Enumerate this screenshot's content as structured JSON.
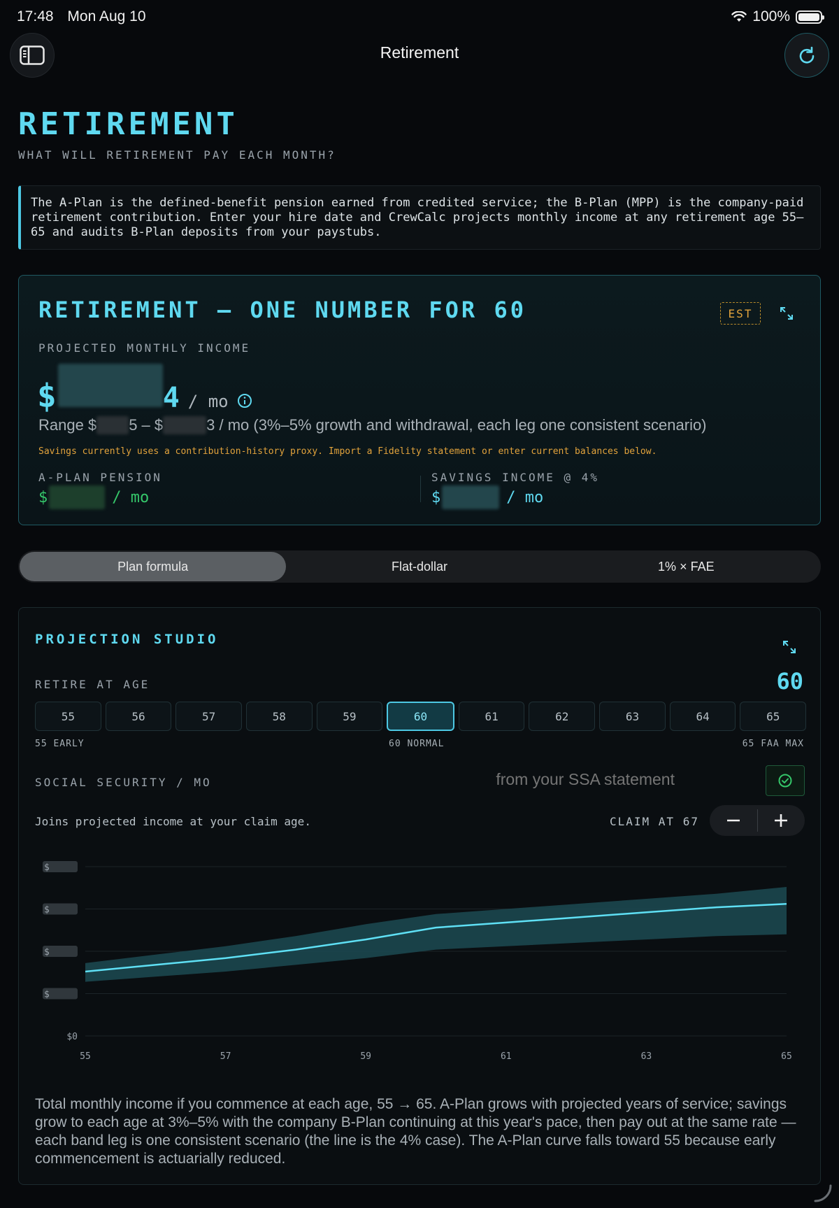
{
  "status_bar": {
    "time": "17:48",
    "date": "Mon Aug 10",
    "battery": "100%"
  },
  "nav": {
    "title": "Retirement"
  },
  "header": {
    "title": "RETIREMENT",
    "subtitle": "WHAT WILL RETIREMENT PAY EACH MONTH?"
  },
  "info": {
    "text": "The A-Plan is the defined-benefit pension earned from credited service; the B-Plan (MPP) is the company-paid retirement contribution. Enter your hire date and CrewCalc projects monthly income at any retirement age 55–65 and audits B-Plan deposits from your paystubs."
  },
  "summary": {
    "title": "RETIREMENT — ONE NUMBER FOR 60",
    "badge": "EST",
    "projected_label": "PROJECTED MONTHLY INCOME",
    "currency": "$",
    "amount_suffix": "4",
    "per_month": "/ mo",
    "range_prefix": "Range $",
    "range_mid": "5 – $",
    "range_suffix": "3 / mo (3%–5% growth and withdrawal, each leg one consistent scenario)",
    "warning": "Savings currently uses a contribution-history proxy. Import a Fidelity statement or enter current balances below.",
    "pension_label": "A-PLAN PENSION",
    "pension_currency": "$",
    "pension_per": "/ mo",
    "savings_label": "SAVINGS INCOME @ 4%",
    "savings_currency": "$",
    "savings_per": "/ mo"
  },
  "formula_tabs": [
    {
      "label": "Plan formula",
      "active": true
    },
    {
      "label": "Flat-dollar",
      "active": false
    },
    {
      "label": "1% × FAE",
      "active": false
    }
  ],
  "studio": {
    "title": "PROJECTION STUDIO",
    "retire_label": "RETIRE AT AGE",
    "retire_value": "60",
    "ages": [
      "55",
      "56",
      "57",
      "58",
      "59",
      "60",
      "61",
      "62",
      "63",
      "64",
      "65"
    ],
    "selected_age": "60",
    "caption_early": "55 EARLY",
    "caption_normal": "60 NORMAL",
    "caption_max": "65 FAA MAX",
    "ss_label": "SOCIAL SECURITY / MO",
    "ss_placeholder": "from your SSA statement",
    "joins_text": "Joins projected income at your claim age.",
    "claim_text": "CLAIM AT 67",
    "description": "Total monthly income if you commence at each age, 55 → 65. A-Plan grows with projected years of service; savings grow to each age at 3%–5% with the company B-Plan continuing at this year's pace, then pay out at the same rate — each band leg is one consistent scenario (the line is the 4% case). The A-Plan curve falls toward 55 because early commencement is actuarially reduced."
  },
  "chart_data": {
    "type": "area",
    "x": [
      55,
      56,
      57,
      58,
      59,
      60,
      61,
      62,
      63,
      64,
      65
    ],
    "x_tick_labels": [
      "55",
      "57",
      "59",
      "61",
      "63",
      "65"
    ],
    "y_tick_labels": [
      "$0"
    ],
    "y_units": "fraction of the unlabeled top gridline value",
    "line_4pct": [
      0.38,
      0.42,
      0.46,
      0.51,
      0.57,
      0.64,
      0.67,
      0.7,
      0.73,
      0.76,
      0.78
    ],
    "band_low_3pct": [
      0.32,
      0.35,
      0.38,
      0.42,
      0.46,
      0.51,
      0.53,
      0.55,
      0.57,
      0.59,
      0.6
    ],
    "band_high_5pct": [
      0.43,
      0.48,
      0.53,
      0.59,
      0.66,
      0.72,
      0.75,
      0.78,
      0.81,
      0.84,
      0.88
    ],
    "grid": true,
    "colors": {
      "line": "#5fe0f5",
      "band": "#1c4a52"
    }
  }
}
